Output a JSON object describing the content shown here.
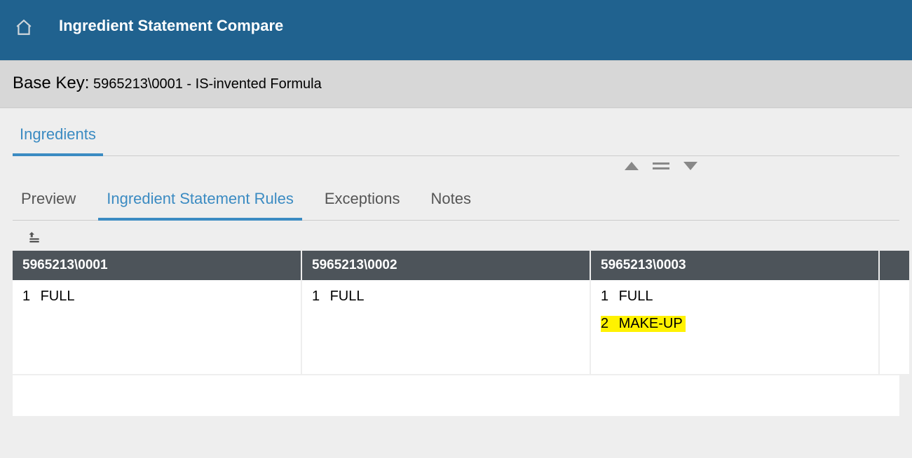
{
  "header": {
    "title": "Ingredient Statement Compare"
  },
  "basekey": {
    "label": "Base Key:",
    "value": "5965213\\0001 - IS-invented Formula"
  },
  "top_tabs": {
    "active": "Ingredients"
  },
  "sub_tabs": {
    "items": [
      {
        "label": "Preview",
        "active": false
      },
      {
        "label": "Ingredient Statement Rules",
        "active": true
      },
      {
        "label": "Exceptions",
        "active": false
      },
      {
        "label": "Notes",
        "active": false
      }
    ]
  },
  "compare": {
    "columns": [
      {
        "header": "5965213\\0001",
        "rows": [
          {
            "seq": "1",
            "text": "FULL",
            "highlight": false
          }
        ]
      },
      {
        "header": "5965213\\0002",
        "rows": [
          {
            "seq": "1",
            "text": "FULL",
            "highlight": false
          }
        ]
      },
      {
        "header": "5965213\\0003",
        "rows": [
          {
            "seq": "1",
            "text": "FULL",
            "highlight": false
          },
          {
            "seq": "2",
            "text": "MAKE-UP",
            "highlight": true
          }
        ]
      }
    ]
  }
}
